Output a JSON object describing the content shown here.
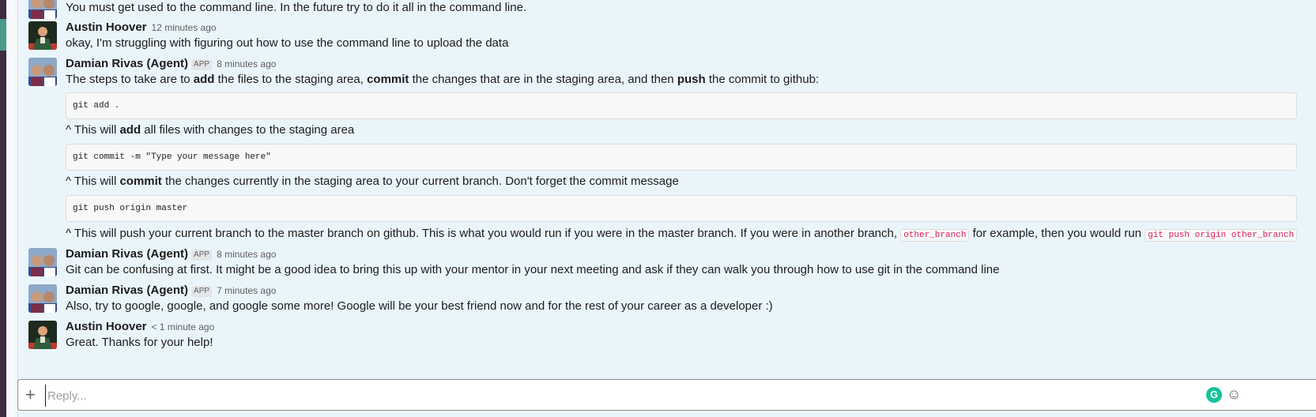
{
  "messages": [
    {
      "text": "You must get used to the command line. In the future try to do it all in the command line."
    },
    {
      "sender": "Austin Hoover",
      "time": "12 minutes ago",
      "text": "okay, I'm struggling with figuring out how to use the command line to upload the data"
    },
    {
      "sender": "Damian Rivas (Agent)",
      "badge": "APP",
      "time": "8 minutes ago",
      "intro": {
        "t1": "The steps to take are to ",
        "b1": "add",
        "t2": " the files to the staging area, ",
        "b2": "commit",
        "t3": " the changes that are in the staging area, and then ",
        "b3": "push",
        "t4": " the commit to github:"
      },
      "code1": "git add .",
      "note1": {
        "t1": "^ This will ",
        "b1": "add",
        "t2": " all files with changes to the staging area"
      },
      "code2": "git commit -m \"Type your message here\"",
      "note2": {
        "t1": "^ This will ",
        "b1": "commit",
        "t2": " the changes currently in the staging area to your current branch. Don't forget the commit message"
      },
      "code3": "git push origin master",
      "note3": {
        "t1": "^ This will push your current branch to the master branch on github. This is what you would run if you were in the master branch. If you were in another branch, ",
        "c1": "other_branch",
        "t2": " for example, then you would run ",
        "c2": "git push origin other_branch"
      }
    },
    {
      "sender": "Damian Rivas (Agent)",
      "badge": "APP",
      "time": "8 minutes ago",
      "text": "Git can be confusing at first. It might be a good idea to bring this up with your mentor in your next meeting and ask if they can walk you through how to use git in the command line"
    },
    {
      "sender": "Damian Rivas (Agent)",
      "badge": "APP",
      "time": "7 minutes ago",
      "text": "Also, try to google, google, and google some more! Google will be your best friend now and for the rest of your career as a developer :)"
    },
    {
      "sender": "Austin Hoover",
      "time": "< 1 minute ago",
      "text": "Great. Thanks for your help!"
    }
  ],
  "reply": {
    "placeholder": "Reply..."
  },
  "icons": {
    "add": "plus-icon",
    "grammarly": "grammarly-icon",
    "emoji": "emoji-icon"
  },
  "colors": {
    "background": "#eaf5fb",
    "inline_code": "#e01e5a",
    "grammarly": "#15c39a"
  }
}
